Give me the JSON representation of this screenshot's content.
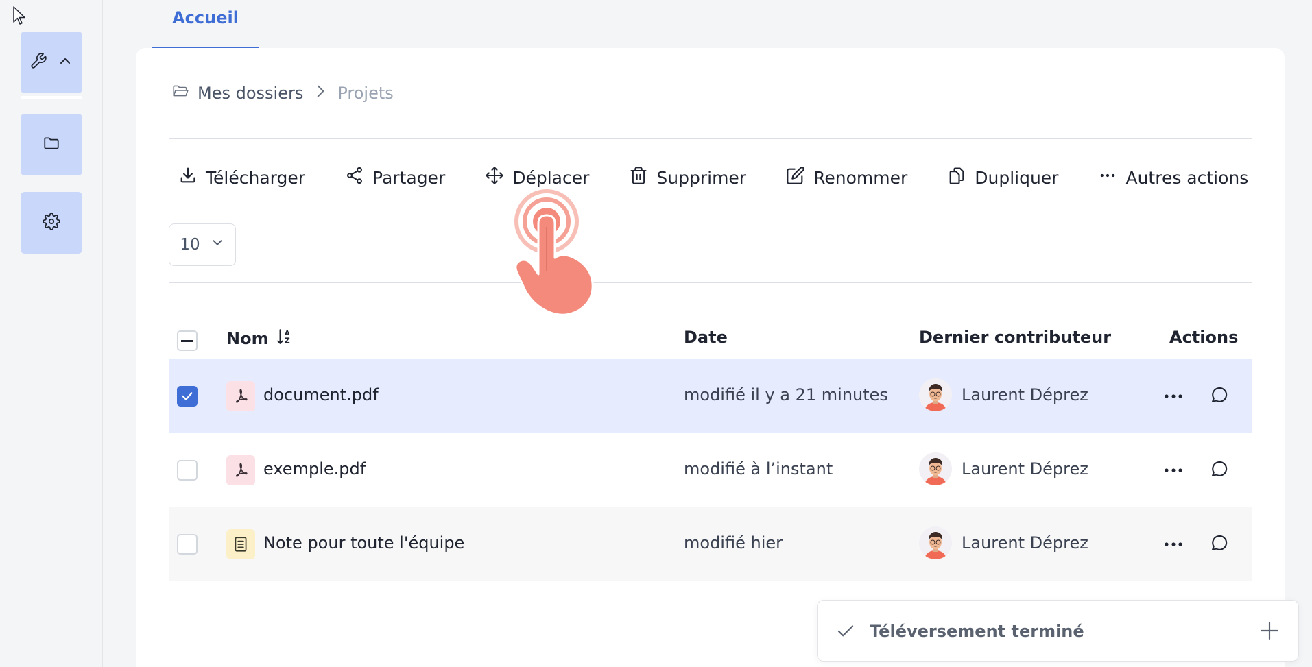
{
  "sidebar": {
    "items": [
      {
        "name": "tools",
        "icon": "wrench-icon",
        "has_chevron": true
      },
      {
        "name": "files",
        "icon": "folder-icon"
      },
      {
        "name": "settings",
        "icon": "gear-icon"
      }
    ]
  },
  "tabs": [
    {
      "label": "Accueil",
      "active": true
    }
  ],
  "breadcrumb": {
    "root": "Mes dossiers",
    "current": "Projets"
  },
  "toolbar": {
    "download": "Télécharger",
    "share": "Partager",
    "move": "Déplacer",
    "delete": "Supprimer",
    "rename": "Renommer",
    "duplicate": "Dupliquer",
    "more": "Autres actions"
  },
  "pagination": {
    "page_size": "10"
  },
  "table": {
    "headers": {
      "name": "Nom",
      "date": "Date",
      "contributor": "Dernier contributeur",
      "actions": "Actions"
    },
    "rows": [
      {
        "name": "document.pdf",
        "type": "pdf",
        "date": "modifié il y a 21 minutes",
        "contributor": "Laurent Déprez",
        "selected": true
      },
      {
        "name": "exemple.pdf",
        "type": "pdf",
        "date": "modifié à l’instant",
        "contributor": "Laurent Déprez",
        "selected": false
      },
      {
        "name": "Note pour toute l'équipe",
        "type": "note",
        "date": "modifié hier",
        "contributor": "Laurent Déprez",
        "selected": false
      }
    ]
  },
  "toast": {
    "message": "Téléversement terminé"
  },
  "colors": {
    "accent": "#3f6dd6",
    "selected_row": "#e6ecfd",
    "rail_button": "#c9d7fa",
    "tap_indicator": "#f38a7c"
  }
}
